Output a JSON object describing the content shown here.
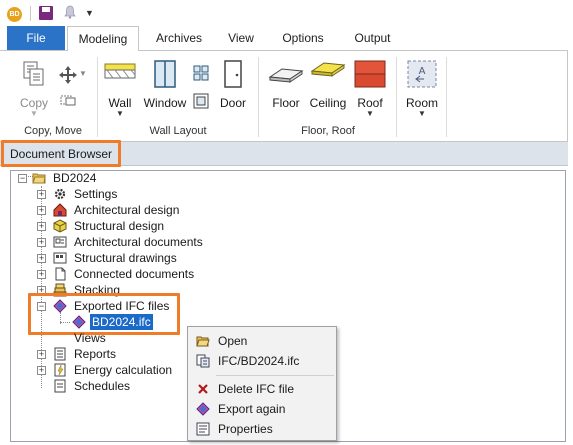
{
  "qat": {
    "logo_text": "BD"
  },
  "tabs": [
    "File",
    "Modeling",
    "Archives",
    "View",
    "Options",
    "Output"
  ],
  "ribbon": {
    "copy": "Copy",
    "wall": "Wall",
    "window": "Window",
    "door": "Door",
    "floor": "Floor",
    "ceiling": "Ceiling",
    "roof": "Roof",
    "room": "Room",
    "group_copy_move": "Copy, Move",
    "group_wall_layout": "Wall Layout",
    "group_floor_roof": "Floor, Roof"
  },
  "panel_title": "Document Browser",
  "tree": {
    "root": "BD2024",
    "items": [
      "Settings",
      "Architectural design",
      "Structural design",
      "Architectural documents",
      "Structural drawings",
      "Connected documents",
      "Stacking",
      "Exported IFC files",
      "BD2024.ifc",
      "Views",
      "Reports",
      "Energy calculation",
      "Schedules"
    ]
  },
  "context_menu": [
    "Open",
    "IFC/BD2024.ifc",
    "Delete IFC file",
    "Export again",
    "Properties"
  ],
  "colors": {
    "accent": "#2b73c6",
    "highlight": "#f07c2a",
    "selection": "#1b6ac9"
  }
}
